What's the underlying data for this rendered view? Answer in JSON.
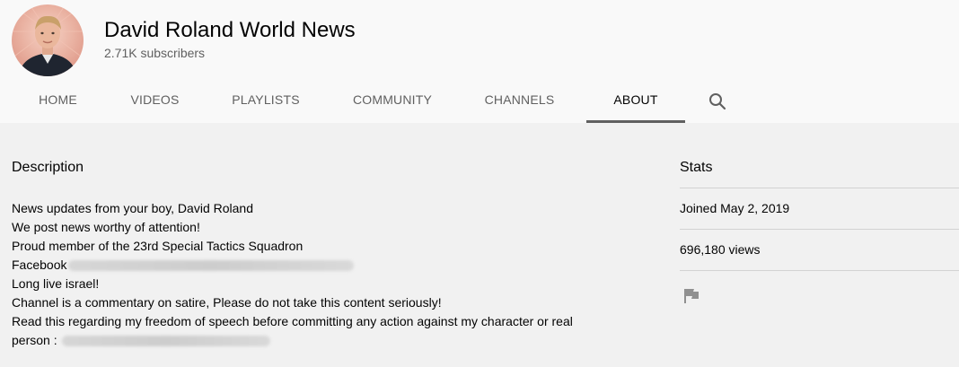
{
  "channel": {
    "name": "David Roland World News",
    "subscribers": "2.71K subscribers",
    "avatar_icon": "avatar-photo-icon"
  },
  "tabs": [
    {
      "label": "HOME",
      "active": false
    },
    {
      "label": "VIDEOS",
      "active": false
    },
    {
      "label": "PLAYLISTS",
      "active": false
    },
    {
      "label": "COMMUNITY",
      "active": false
    },
    {
      "label": "CHANNELS",
      "active": false
    },
    {
      "label": "ABOUT",
      "active": true
    }
  ],
  "search_icon": "search-icon",
  "description": {
    "title": "Description",
    "lines": [
      "News updates from your boy, David Roland",
      "We post news worthy of attention!",
      "Proud member of the 23rd Special Tactics Squadron",
      "Facebook",
      "Long live israel!",
      "Channel is a commentary on satire, Please do not take this content seriously!",
      "Read this regarding my freedom of speech before committing any action against my character or real",
      "person : "
    ]
  },
  "stats": {
    "title": "Stats",
    "joined": "Joined May 2, 2019",
    "views": "696,180 views",
    "flag_icon": "flag-icon"
  },
  "colors": {
    "header_bg": "#f9f9f9",
    "page_bg": "#f1f1f1",
    "text_primary": "#030303",
    "text_secondary": "#606060",
    "divider": "#d3d3d3"
  }
}
